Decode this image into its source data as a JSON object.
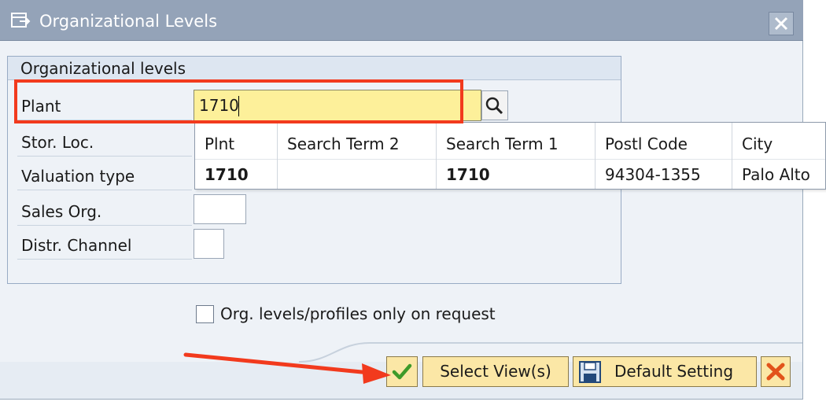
{
  "window": {
    "title": "Organizational Levels"
  },
  "group": {
    "title": "Organizational levels",
    "fields": [
      {
        "label": "Plant",
        "value": "1710"
      },
      {
        "label": "Stor. Loc.",
        "value": ""
      },
      {
        "label": "Valuation type",
        "value": ""
      },
      {
        "label": "Sales Org.",
        "value": ""
      },
      {
        "label": "Distr. Channel",
        "value": ""
      }
    ]
  },
  "dropdown": {
    "headers": [
      "Plnt",
      "Search Term 2",
      "Search Term 1",
      "Postl Code",
      "City"
    ],
    "rows": [
      [
        "1710",
        "",
        "1710",
        "94304-1355",
        "Palo Alto"
      ]
    ]
  },
  "checkbox": {
    "label": "Org. levels/profiles only on request",
    "checked": false
  },
  "buttons": {
    "confirm_icon": "checkmark-icon",
    "select_views": "Select View(s)",
    "default_setting": "Default Setting",
    "cancel_icon": "cancel-icon"
  },
  "annotations": {
    "highlight_color": "#f23a1d",
    "arrow_color": "#f23a1d"
  }
}
